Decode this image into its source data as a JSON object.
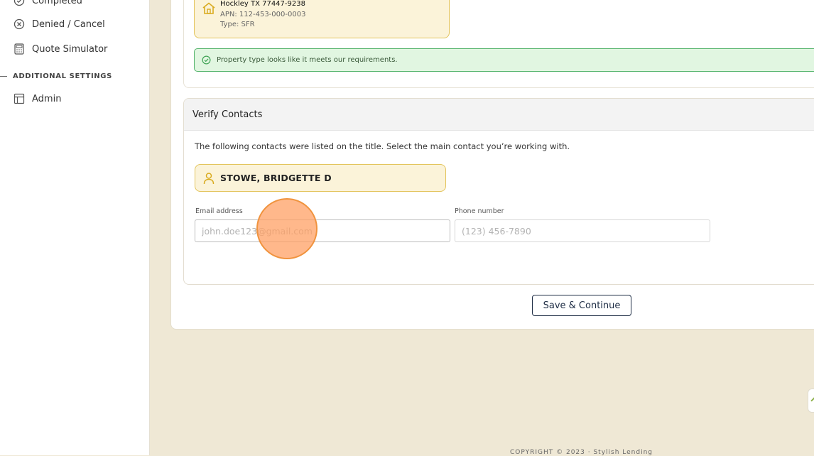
{
  "sidebar": {
    "items": [
      {
        "label": "Completed",
        "icon": "check-circle-icon"
      },
      {
        "label": "Denied / Cancel",
        "icon": "x-circle-icon"
      },
      {
        "label": "Quote Simulator",
        "icon": "calculator-icon"
      }
    ],
    "section_label": "ADDITIONAL SETTINGS",
    "admin": {
      "label": "Admin",
      "icon": "layout-icon"
    }
  },
  "property": {
    "address_line": "Hockley TX 77447-9238",
    "apn": "APN: 112-453-000-0003",
    "type": "Type: SFR",
    "icon": "house-icon"
  },
  "alert": {
    "message": "Property type looks like it meets our requirements.",
    "icon": "check-circle-icon",
    "color": "#52b36a"
  },
  "verify_contacts": {
    "title": "Verify Contacts",
    "description": "The following contacts were listed on the title. Select the main contact you’re working with.",
    "contact_name": "STOWE, BRIDGETTE D",
    "contact_icon": "person-icon",
    "email_label": "Email address",
    "email_placeholder": "john.doe123@gmail.com",
    "email_value": "",
    "phone_label": "Phone number",
    "phone_placeholder": "(123) 456-7890",
    "phone_value": ""
  },
  "actions": {
    "save_label": "Save & Continue"
  },
  "footer": {
    "text": "COPYRIGHT © 2023 · Stylish Lending"
  },
  "colors": {
    "accent_yellow": "#e3c45c",
    "chip_bg": "#fbf3d9",
    "page_bg": "#efe8d5",
    "button_navy": "#1d2c44"
  }
}
